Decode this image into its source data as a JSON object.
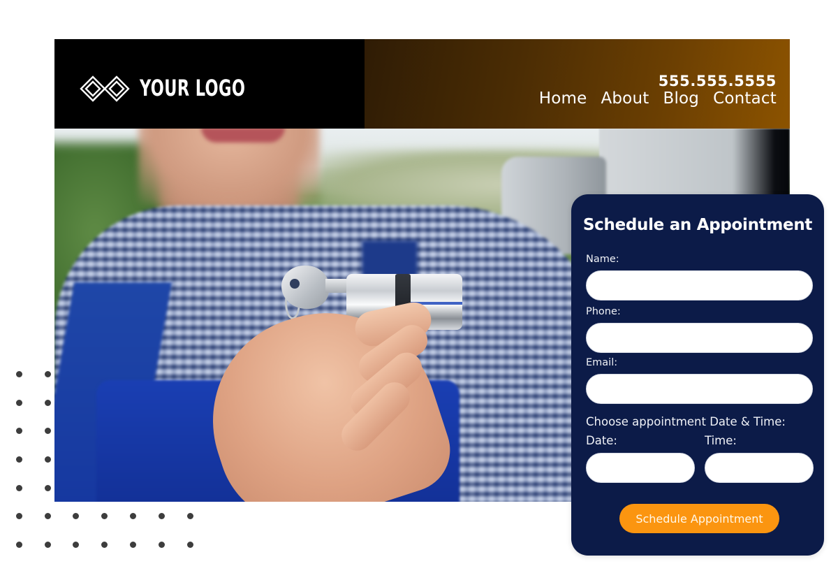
{
  "brand": {
    "logo_text": "YOUR LOGO",
    "logo_icon": "interlocking-diamonds-icon"
  },
  "header": {
    "phone": "555.555.5555",
    "nav": [
      {
        "label": "Home"
      },
      {
        "label": "About"
      },
      {
        "label": "Blog"
      },
      {
        "label": "Contact"
      }
    ]
  },
  "hero": {
    "image_description": "Smiling locksmith in blue plaid shirt and overalls holding a key inserted in a lock cylinder"
  },
  "form": {
    "title": "Schedule an Appointment",
    "fields": {
      "name": {
        "label": "Name:",
        "value": "",
        "placeholder": ""
      },
      "phone": {
        "label": "Phone:",
        "value": "",
        "placeholder": ""
      },
      "email": {
        "label": "Email:",
        "value": "",
        "placeholder": ""
      },
      "datetime_prompt": "Choose appointment Date & Time:",
      "date": {
        "label": "Date:",
        "value": "",
        "placeholder": ""
      },
      "time": {
        "label": "Time:",
        "value": "",
        "placeholder": ""
      }
    },
    "submit_label": "Schedule Appointment"
  },
  "colors": {
    "header_left": "#000000",
    "header_gradient_start": "#2f1c05",
    "header_gradient_end": "#8c5300",
    "form_background": "#0c1b48",
    "submit_button": "#fb9510",
    "decor_dots": "#3d3d3d"
  }
}
